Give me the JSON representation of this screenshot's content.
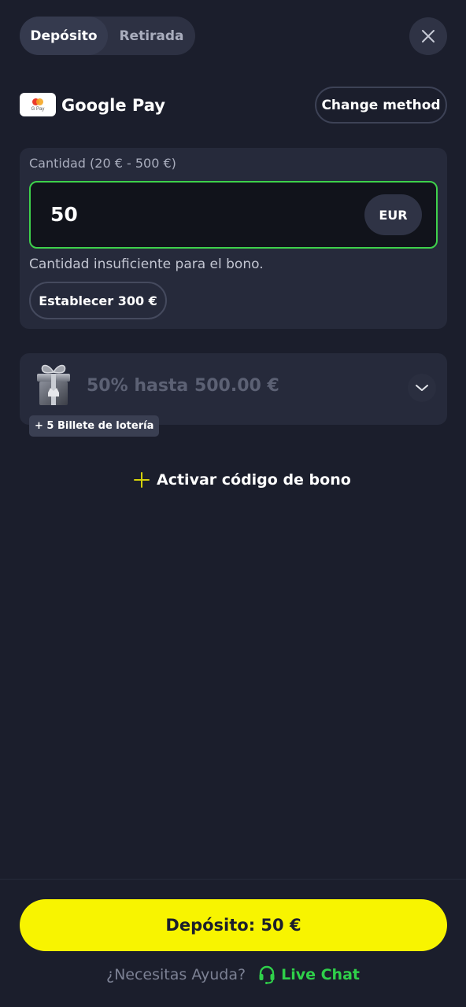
{
  "tabs": [
    {
      "label": "Depósito",
      "active": true
    },
    {
      "label": "Retirada",
      "active": false
    }
  ],
  "close_icon": "close-icon",
  "payment_method": {
    "logo_text": "G Pay",
    "name": "Google Pay",
    "change_label": "Change method"
  },
  "amount": {
    "label": "Cantidad (20 € - 500 €)",
    "value": "50",
    "currency": "EUR",
    "warning": "Cantidad insuficiente para el bono.",
    "set_button": "Establecer 300 €"
  },
  "bonus": {
    "text": "50% hasta 500.00 €",
    "badge": "+ 5 Billete de lotería",
    "icon": "gift-icon"
  },
  "activate_code": {
    "label": "Activar código de bono"
  },
  "footer": {
    "deposit_button": "Depósito: 50 €",
    "help_text": "¿Necesitas Ayuda?",
    "live_chat": "Live Chat"
  },
  "colors": {
    "background": "#1b1e2c",
    "card": "#262a3b",
    "accent_yellow": "#f8f400",
    "accent_green": "#3ed14b",
    "live_chat_green": "#2fd04a"
  }
}
